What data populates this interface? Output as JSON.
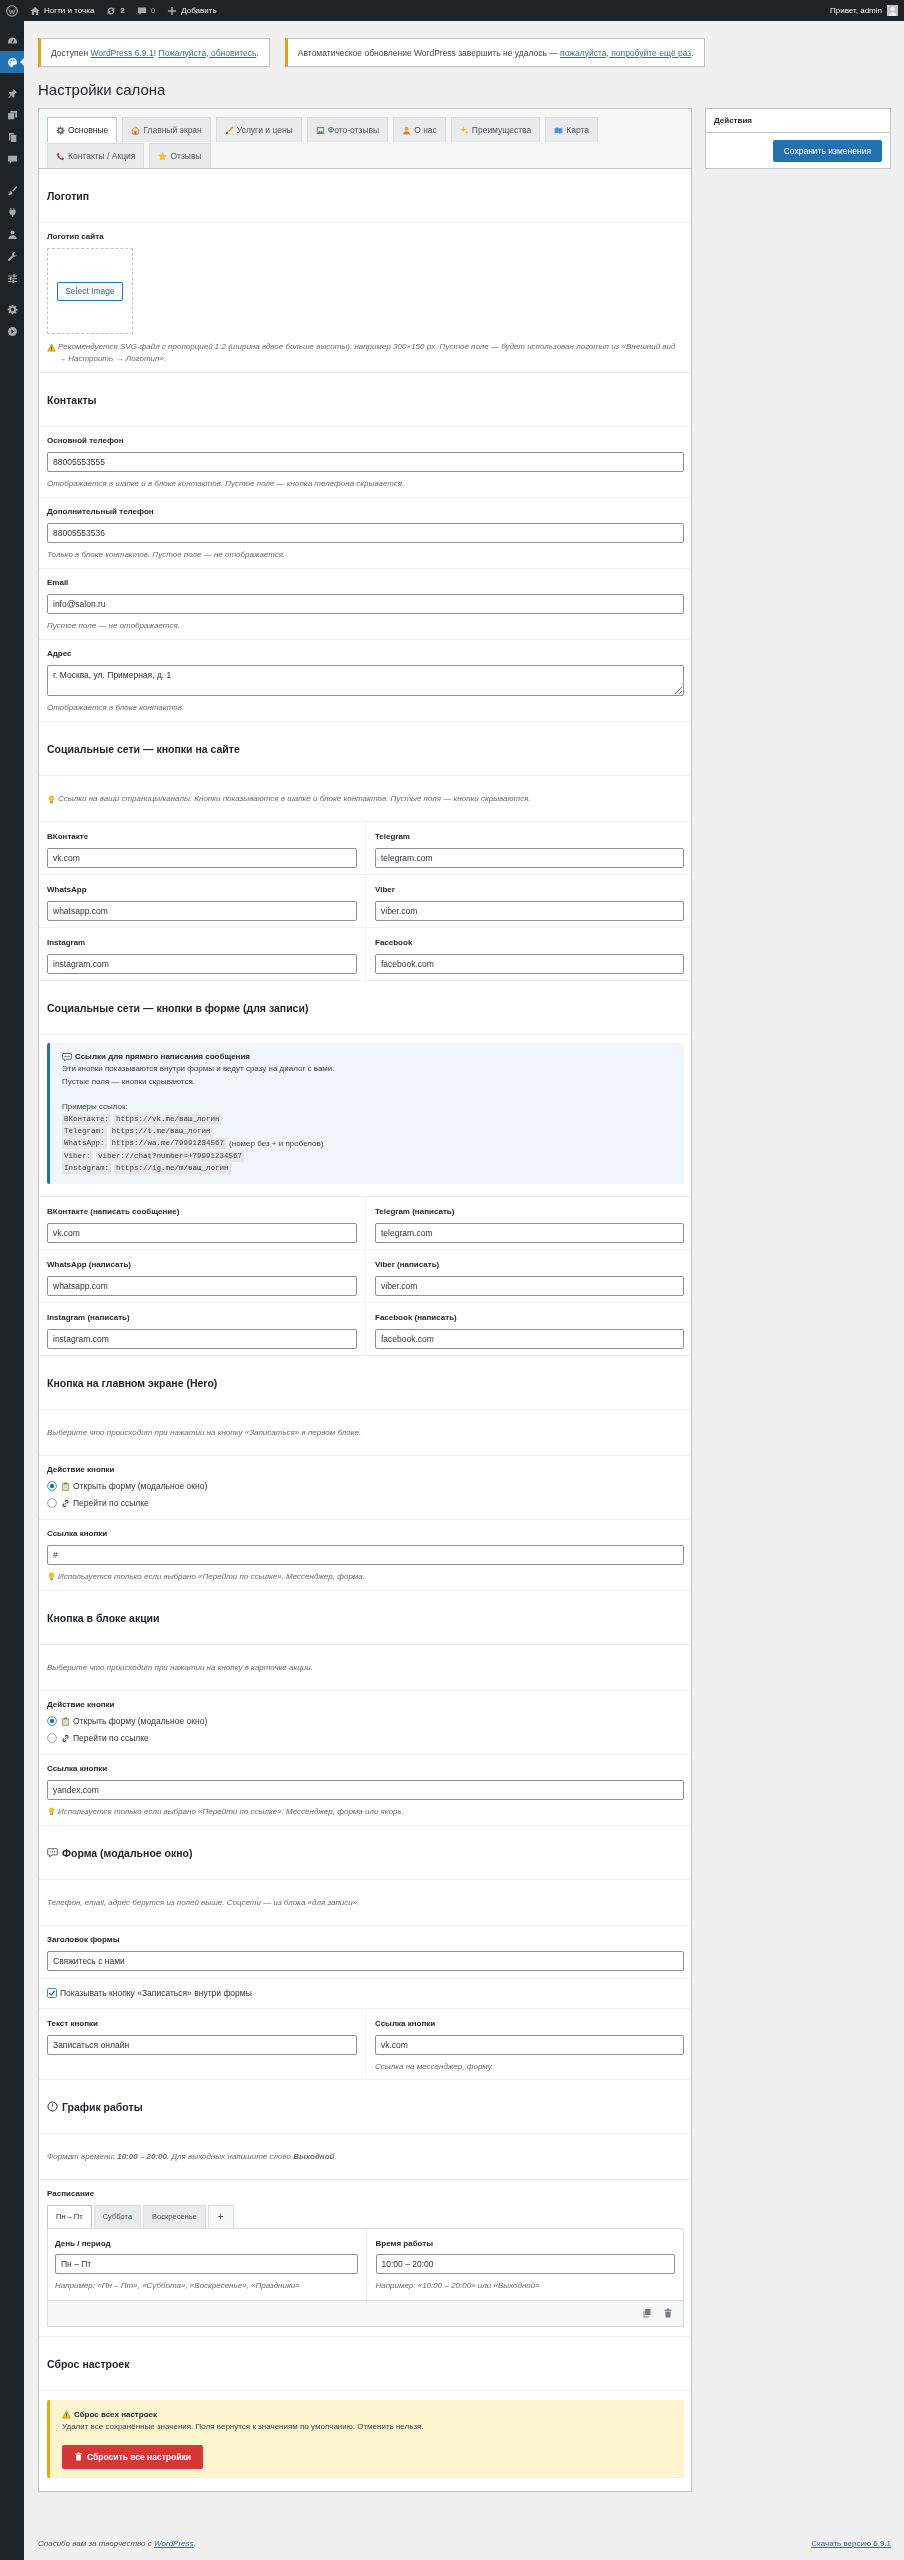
{
  "admin_bar": {
    "site_name": "Ногти и точка",
    "updates": "2",
    "comments": "0",
    "new_label": "Добавить",
    "greeting": "Привет, admin"
  },
  "sidebar": {
    "items": [
      {
        "selected": false
      },
      {
        "selected": true
      },
      {
        "selected": false
      },
      {
        "selected": false
      },
      {
        "selected": false
      },
      {
        "selected": false
      },
      {
        "selected": false
      },
      {
        "selected": false
      },
      {
        "selected": false
      },
      {
        "selected": false
      },
      {
        "selected": false
      },
      {
        "selected": false
      },
      {
        "selected": false
      }
    ]
  },
  "notices": [
    {
      "segments": [
        {
          "kind": "text",
          "text": "Доступен "
        },
        {
          "kind": "link",
          "text": "WordPress 6.9.1"
        },
        {
          "kind": "text",
          "text": "! "
        },
        {
          "kind": "link",
          "text": "Пожалуйста, обновитесь"
        },
        {
          "kind": "text",
          "text": "."
        }
      ]
    },
    {
      "segments": [
        {
          "kind": "text",
          "text": "Автоматическое обновление WordPress завершить не удалось — "
        },
        {
          "kind": "link",
          "text": "пожалуйста, попробуйте ещё раз"
        },
        {
          "kind": "text",
          "text": "."
        }
      ]
    }
  ],
  "page_title": "Настройки салона",
  "tabs": [
    {
      "label": "Основные",
      "selected": true
    },
    {
      "label": "Главный экран",
      "selected": false
    },
    {
      "label": "Услуги и цены",
      "selected": false
    },
    {
      "label": "Фото-отзывы",
      "selected": false
    },
    {
      "label": "О нас",
      "selected": false
    },
    {
      "label": "Преимущества",
      "selected": false
    },
    {
      "label": "Карта",
      "selected": false
    },
    {
      "label": "Контакты / Акция",
      "selected": false
    },
    {
      "label": "Отзывы",
      "selected": false
    }
  ],
  "actions": {
    "title": "Действия",
    "save_button": "Сохранить изменения"
  },
  "sections": [
    {
      "title": "Логотип",
      "rows": [
        {
          "kind": "image",
          "label": "Логотип сайта",
          "button": "Select Image",
          "warning": "Рекомендуется SVG-файл с пропорцией 1:2 (ширина вдвое больше высоты), например 300×150 px. Пустое поле — будет использован логотип из «Внешний вид → Настроить → Логотип»."
        }
      ]
    },
    {
      "title": "Контакты",
      "rows": [
        {
          "kind": "text",
          "label": "Основной телефон",
          "value": "88005553555",
          "description": "Отображается в шапке и в блоке контактов. Пустое поле — кнопка телефона скрывается."
        },
        {
          "kind": "text",
          "label": "Дополнительный телефон",
          "value": "88005553536",
          "description": "Только в блоке контактов. Пустое поле — не отображается."
        },
        {
          "kind": "text",
          "label": "Email",
          "value": "info@salon.ru",
          "description": "Пустое поле — не отображается."
        },
        {
          "kind": "textarea",
          "label": "Адрес",
          "value": "г. Москва, ул. Примерная, д. 1",
          "description": "Отображается в блоке контактов."
        }
      ]
    },
    {
      "title": "Социальные сети — кнопки на сайте",
      "rows": [
        {
          "kind": "tip",
          "text": "Ссылки на ваши страницы/каналы. Кнопки показываются в шапке и блоке контактов. Пустые поля — кнопки скрываются."
        },
        {
          "kind": "pair",
          "fields": [
            {
              "label": "ВКонтакте",
              "value": "vk.com"
            },
            {
              "label": "Telegram",
              "value": "telegram.com"
            }
          ]
        },
        {
          "kind": "pair",
          "fields": [
            {
              "label": "WhatsApp",
              "value": "whatsapp.com"
            },
            {
              "label": "Viber",
              "value": "viber.com"
            }
          ]
        },
        {
          "kind": "pair",
          "fields": [
            {
              "label": "Instagram",
              "value": "instagram.com"
            },
            {
              "label": "Facebook",
              "value": "facebook.com"
            }
          ]
        }
      ]
    },
    {
      "title": "Социальные сети — кнопки в форме (для записи)",
      "rows": [
        {
          "kind": "info",
          "title": "Ссылки для прямого написания сообщения",
          "lines": [
            "Эти кнопки показываются внутри формы и ведут сразу на диалог с вами.",
            "Пустые поля — кнопки скрываются."
          ],
          "examples_title": "Примеры ссылок:",
          "examples": [
            {
              "name": "ВКонтакте:",
              "url": "https://vk.me/ваш_логин"
            },
            {
              "name": "Telegram:",
              "url": "https://t.me/ваш_логин"
            },
            {
              "name": "WhatsApp:",
              "url": "https://wa.me/79991234567",
              "note": "(номер без + и пробелов)"
            },
            {
              "name": "Viber:",
              "url": "viber://chat?number=+79991234567"
            },
            {
              "name": "Instagram:",
              "url": "https://ig.me/m/ваш_логин"
            }
          ]
        },
        {
          "kind": "pair",
          "fields": [
            {
              "label": "ВКонтакте (написать сообщение)",
              "value": "vk.com"
            },
            {
              "label": "Telegram (написать)",
              "value": "telegram.com"
            }
          ]
        },
        {
          "kind": "pair",
          "fields": [
            {
              "label": "WhatsApp (написать)",
              "value": "whatsapp.com"
            },
            {
              "label": "Viber (написать)",
              "value": "viber.com"
            }
          ]
        },
        {
          "kind": "pair",
          "fields": [
            {
              "label": "Instagram (написать)",
              "value": "instagram.com"
            },
            {
              "label": "Facebook (написать)",
              "value": "facebook.com"
            }
          ]
        }
      ]
    },
    {
      "title": "Кнопка на главном экране (Hero)",
      "rows": [
        {
          "kind": "description",
          "text": "Выберите что происходит при нажатии на кнопку «Записаться» в первом блоке."
        },
        {
          "kind": "radio",
          "label": "Действие кнопки",
          "options": [
            {
              "label": "Открыть форму (модальное окно)",
              "selected": true
            },
            {
              "label": "Перейти по ссылке",
              "selected": false
            }
          ]
        },
        {
          "kind": "text",
          "label": "Ссылка кнопки",
          "value": "#",
          "tip": "Используется только если выбрано «Перейти по ссылке». Мессенджер, форма."
        }
      ]
    },
    {
      "title": "Кнопка в блоке акции",
      "rows": [
        {
          "kind": "description",
          "text": "Выберите что происходит при нажатии на кнопку в карточке акции."
        },
        {
          "kind": "radio",
          "label": "Действие кнопки",
          "options": [
            {
              "label": "Открыть форму (модальное окно)",
              "selected": true
            },
            {
              "label": "Перейти по ссылке",
              "selected": false
            }
          ]
        },
        {
          "kind": "text",
          "label": "Ссылка кнопки",
          "value": "yandex.com",
          "tip": "Используется только если выбрано «Перейти по ссылке». Мессенджер, форма или якорь."
        }
      ]
    },
    {
      "title": "Форма (модальное окно)",
      "rows": [
        {
          "kind": "description",
          "text": "Телефон, email, адрес берутся из полей выше. Соцсети — из блока «для записи»."
        },
        {
          "kind": "text",
          "label": "Заголовок формы",
          "value": "Свяжитесь с нами"
        },
        {
          "kind": "checkbox",
          "label": "Показывать кнопку «Записаться» внутри формы",
          "checked": true
        },
        {
          "kind": "pair",
          "fields": [
            {
              "label": "Текст кнопки",
              "value": "Записаться онлайн"
            },
            {
              "label": "Ссылка кнопки",
              "value": "vk.com",
              "description": "Ссылка на мессенджер, форму."
            }
          ]
        }
      ]
    },
    {
      "title": "График работы",
      "rows": [
        {
          "kind": "description",
          "text": "Формат времени: **10:00 – 20:00**. Для выходных напишите слово **Выходной**."
        },
        {
          "kind": "schedule",
          "label": "Расписание",
          "tabs": [
            {
              "label": "Пн – Пт",
              "selected": true
            },
            {
              "label": "Суббота",
              "selected": false
            },
            {
              "label": "Воскресенье",
              "selected": false
            }
          ],
          "add_tab": "+",
          "fields": [
            {
              "label": "День / период",
              "value": "Пн – Пт",
              "description": "Например: «Пн – Пт», «Суббота», «Воскресенье», «Праздники»"
            },
            {
              "label": "Время работы",
              "value": "10:00 – 20:00",
              "description": "Например: «10:00 – 20:00» или «Выходной»"
            }
          ]
        }
      ]
    },
    {
      "title": "Сброс настроек",
      "rows": [
        {
          "kind": "danger",
          "title": "Сброс всех настроек",
          "text": "Удалит все сохранённые значения. Поля вернутся к значениям по умолчанию. Отменить нельзя.",
          "button": "Сбросить все настройки"
        }
      ]
    }
  ],
  "footer": {
    "segments": [
      {
        "kind": "text",
        "text": "Спасибо вам за творчество с "
      },
      {
        "kind": "link",
        "text": "WordPress"
      },
      {
        "kind": "text",
        "text": "."
      }
    ],
    "version_link": "Скачать версию 6.9.1"
  }
}
